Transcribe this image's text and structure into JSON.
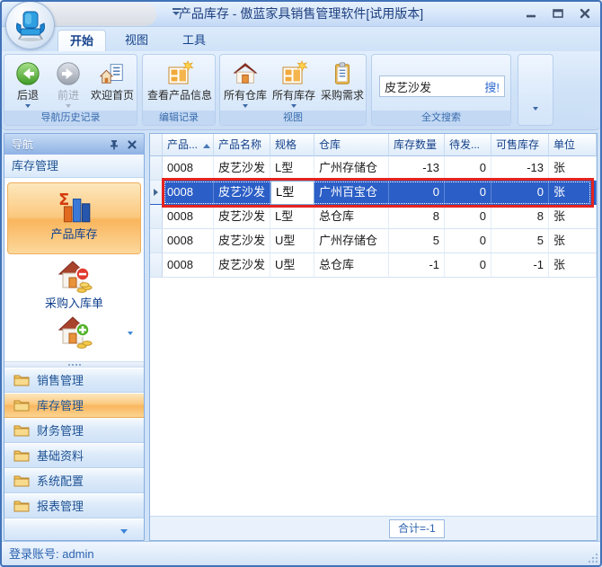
{
  "window": {
    "title": "产品库存 - 傲蓝家具销售管理软件[试用版本]"
  },
  "tabs": {
    "start": "开始",
    "view": "视图",
    "tools": "工具"
  },
  "ribbon": {
    "nav_group": {
      "label": "导航历史记录",
      "back": "后退",
      "forward": "前进",
      "welcome": "欢迎首页"
    },
    "edit_group": {
      "label": "编辑记录",
      "view_product": "查看产品信息"
    },
    "view_group": {
      "label": "视图",
      "all_warehouses": "所有仓库",
      "all_stock": "所有库存",
      "purchase_demand": "采购需求"
    },
    "search_group": {
      "label": "全文搜索",
      "value": "皮艺沙发",
      "search_button": "搜!"
    }
  },
  "nav": {
    "title": "导航",
    "section_header": "库存管理",
    "product_stock": "产品库存",
    "purchase_inbound": "采购入库单",
    "groups": [
      "销售管理",
      "库存管理",
      "财务管理",
      "基础资料",
      "系统配置",
      "报表管理"
    ],
    "active_group": "库存管理"
  },
  "table": {
    "columns": [
      "产品...",
      "产品名称",
      "规格",
      "仓库",
      "库存数量",
      "待发...",
      "可售库存",
      "单位"
    ],
    "rows": [
      [
        "0008",
        "皮艺沙发",
        "L型",
        "广州存储仓",
        "-13",
        "0",
        "-13",
        "张"
      ],
      [
        "0008",
        "皮艺沙发",
        "L型",
        "广州百宝仓",
        "0",
        "0",
        "0",
        "张"
      ],
      [
        "0008",
        "皮艺沙发",
        "L型",
        "总仓库",
        "8",
        "0",
        "8",
        "张"
      ],
      [
        "0008",
        "皮艺沙发",
        "U型",
        "广州存储仓",
        "5",
        "0",
        "5",
        "张"
      ],
      [
        "0008",
        "皮艺沙发",
        "U型",
        "总仓库",
        "-1",
        "0",
        "-1",
        "张"
      ]
    ],
    "selected_row_index": 1,
    "footer_total": "合计=-1"
  },
  "status": {
    "login": "登录账号: admin"
  }
}
